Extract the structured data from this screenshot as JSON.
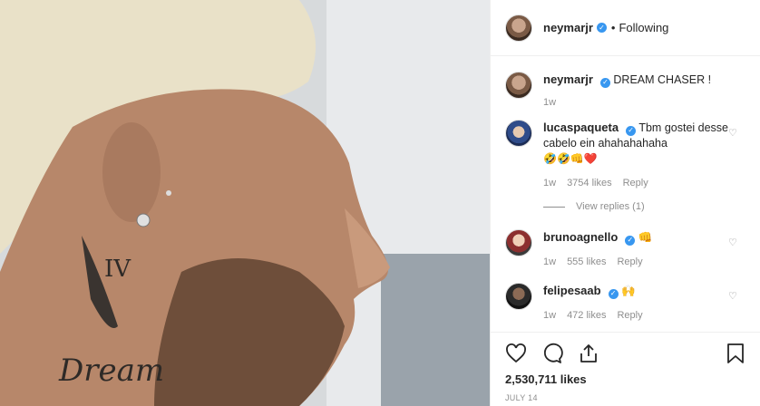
{
  "post": {
    "username": "neymarjr",
    "follow_status": "Following",
    "caption": "DREAM CHASER !",
    "caption_time": "1w",
    "likes": "2,530,711 likes",
    "date": "JULY 14"
  },
  "comments": [
    {
      "username": "lucaspaqueta",
      "text": "Tbm gostei desse cabelo ein ahahahahaha",
      "emoji": "🤣🤣👊❤️",
      "time": "1w",
      "likes": "3754 likes",
      "reply": "Reply",
      "view_replies": "View replies (1)"
    },
    {
      "username": "brunoagnello",
      "text": "👊",
      "time": "1w",
      "likes": "555 likes",
      "reply": "Reply"
    },
    {
      "username": "felipesaab",
      "text": "🙌",
      "time": "1w",
      "likes": "472 likes",
      "reply": "Reply"
    }
  ],
  "icons": {
    "like": "heart-icon",
    "comment": "comment-icon",
    "share": "share-icon",
    "save": "bookmark-icon",
    "verified": "verified-badge-icon",
    "comment_like": "heart-outline-icon"
  },
  "colors": {
    "verified": "#3897f0",
    "secondary_text": "#8e8e8e",
    "primary_text": "#262626",
    "border": "#efefef"
  }
}
